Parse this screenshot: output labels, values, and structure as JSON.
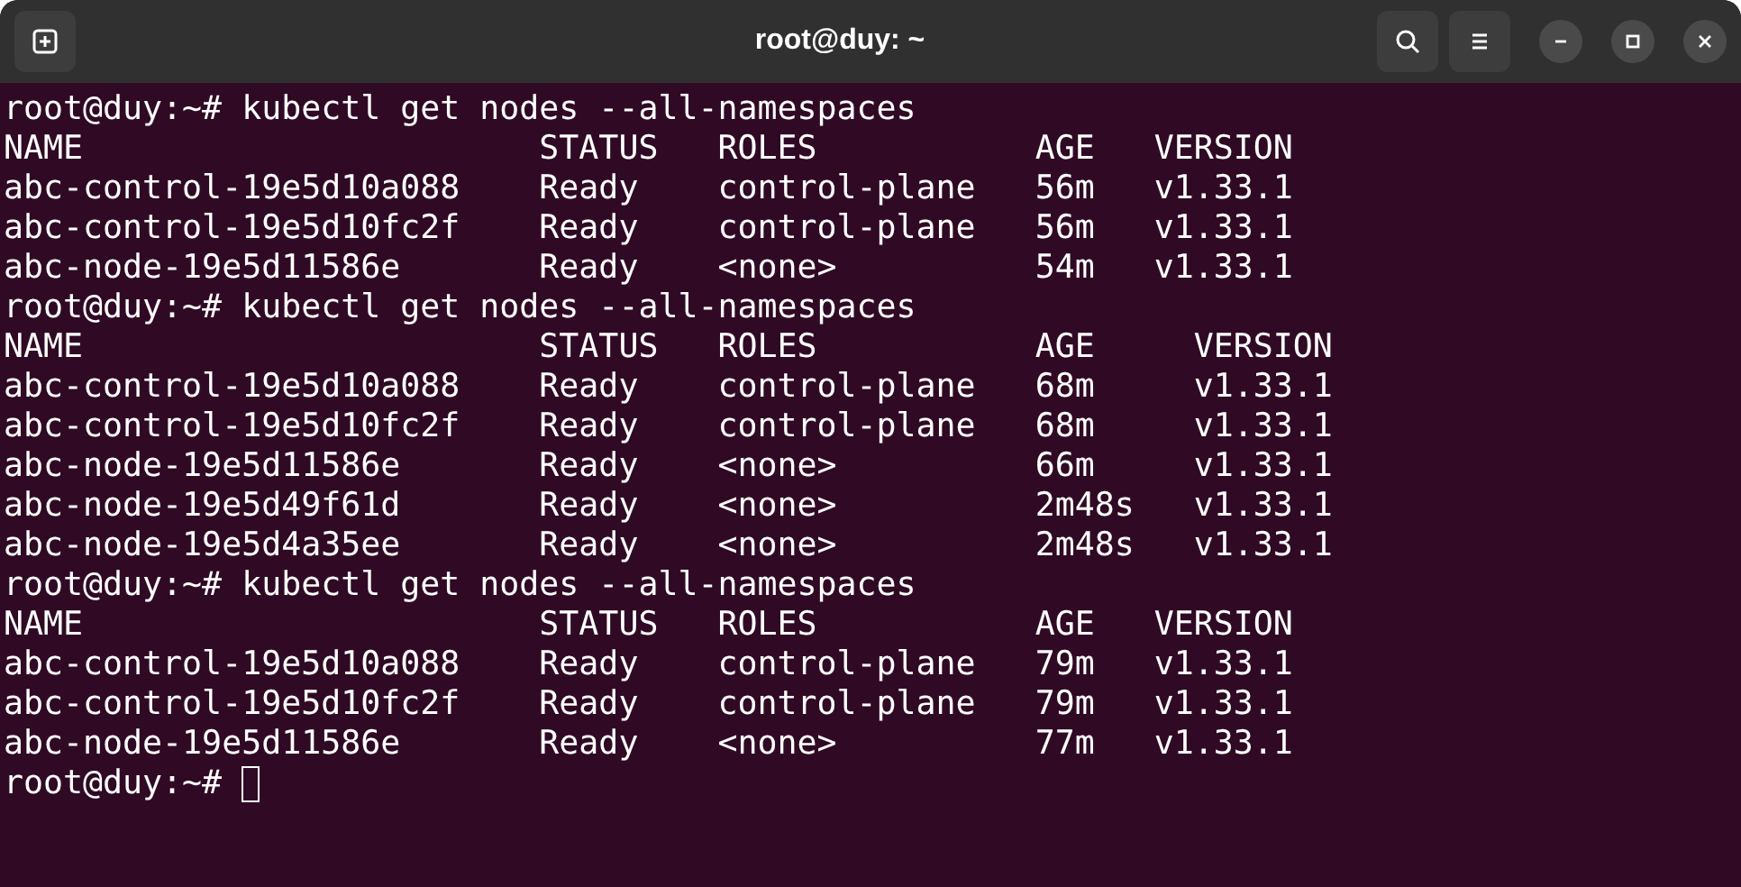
{
  "window": {
    "title": "root@duy: ~"
  },
  "lines": [
    "root@duy:~# kubectl get nodes --all-namespaces",
    "NAME                       STATUS   ROLES           AGE   VERSION",
    "abc-control-19e5d10a088    Ready    control-plane   56m   v1.33.1",
    "abc-control-19e5d10fc2f    Ready    control-plane   56m   v1.33.1",
    "abc-node-19e5d11586e       Ready    <none>          54m   v1.33.1",
    "root@duy:~# kubectl get nodes --all-namespaces",
    "NAME                       STATUS   ROLES           AGE     VERSION",
    "abc-control-19e5d10a088    Ready    control-plane   68m     v1.33.1",
    "abc-control-19e5d10fc2f    Ready    control-plane   68m     v1.33.1",
    "abc-node-19e5d11586e       Ready    <none>          66m     v1.33.1",
    "abc-node-19e5d49f61d       Ready    <none>          2m48s   v1.33.1",
    "abc-node-19e5d4a35ee       Ready    <none>          2m48s   v1.33.1",
    "root@duy:~# kubectl get nodes --all-namespaces",
    "NAME                       STATUS   ROLES           AGE   VERSION",
    "abc-control-19e5d10a088    Ready    control-plane   79m   v1.33.1",
    "abc-control-19e5d10fc2f    Ready    control-plane   79m   v1.33.1",
    "abc-node-19e5d11586e       Ready    <none>          77m   v1.33.1"
  ],
  "prompt": "root@duy:~#"
}
